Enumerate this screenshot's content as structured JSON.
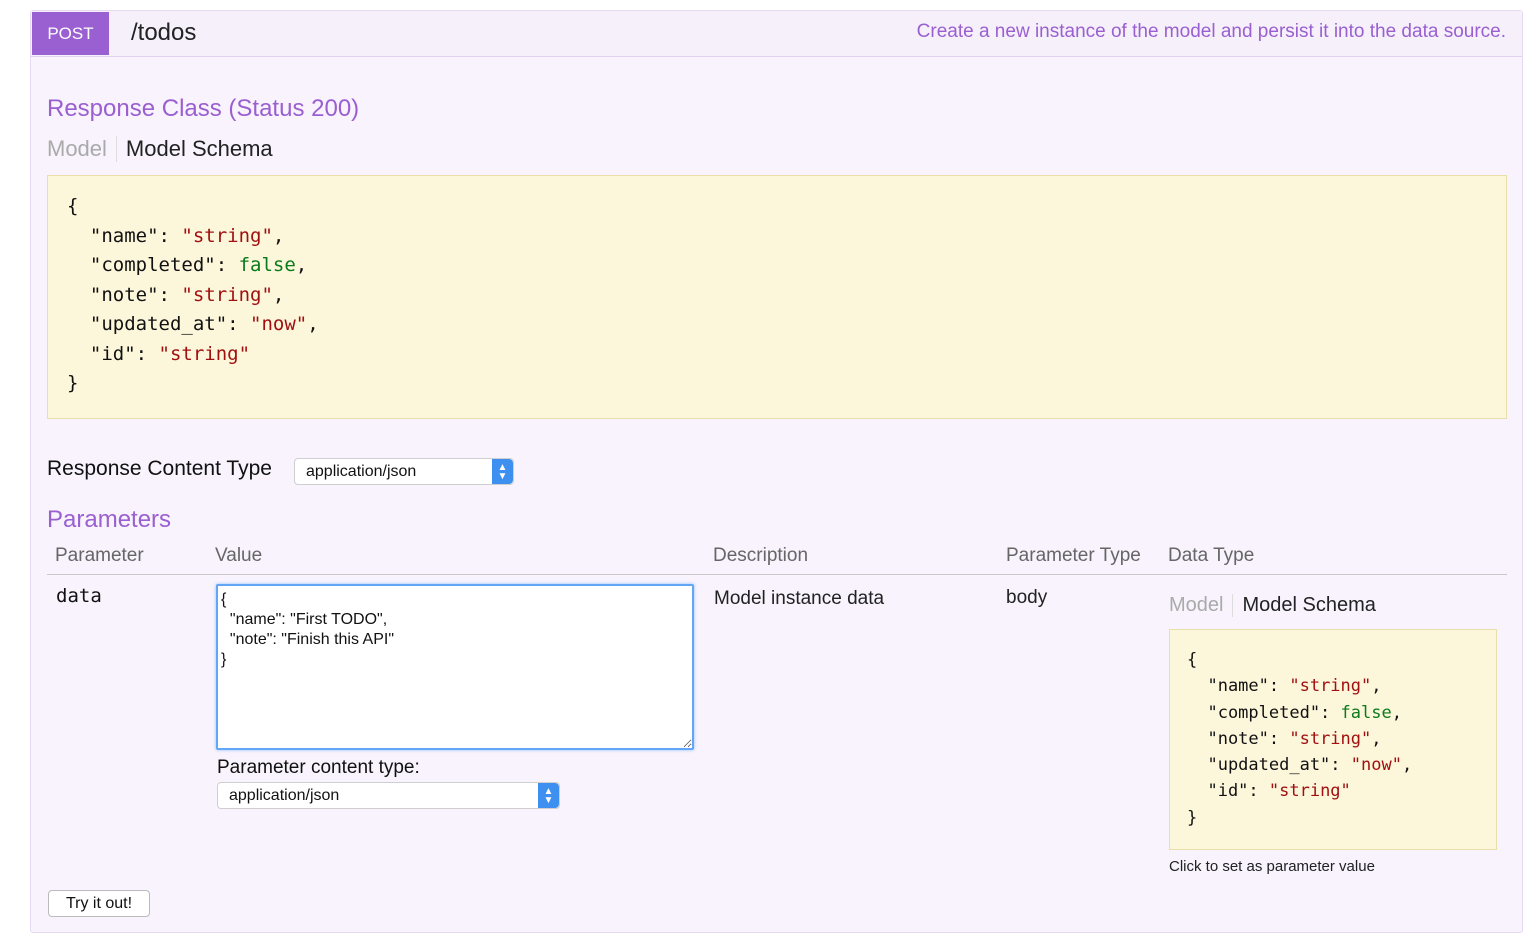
{
  "operation": {
    "method": "POST",
    "path": "/todos",
    "summary": "Create a new instance of the model and persist it into the data source.",
    "method_color": "#9a5fd0"
  },
  "response_class": {
    "heading": "Response Class (Status 200)",
    "tabs": [
      "Model",
      "Model Schema"
    ],
    "schema": {
      "open": "{",
      "close": "}",
      "fields": [
        {
          "key": "\"name\"",
          "value": "\"string\"",
          "type": "string",
          "comma": ","
        },
        {
          "key": "\"completed\"",
          "value": "false",
          "type": "bool",
          "comma": ","
        },
        {
          "key": "\"note\"",
          "value": "\"string\"",
          "type": "string",
          "comma": ","
        },
        {
          "key": "\"updated_at\"",
          "value": "\"now\"",
          "type": "string",
          "comma": ","
        },
        {
          "key": "\"id\"",
          "value": "\"string\"",
          "type": "string",
          "comma": ""
        }
      ]
    }
  },
  "response_content_type": {
    "label": "Response Content Type",
    "selected": "application/json"
  },
  "parameters": {
    "heading": "Parameters",
    "columns": [
      "Parameter",
      "Value",
      "Description",
      "Parameter Type",
      "Data Type"
    ],
    "row": {
      "name": "data",
      "value": "{\n  \"name\": \"First TODO\",\n  \"note\": \"Finish this API\"\n}",
      "content_type_label": "Parameter content type:",
      "content_type_selected": "application/json",
      "description": "Model instance data",
      "param_type": "body",
      "data_type_tabs": [
        "Model",
        "Model Schema"
      ],
      "hint": "Click to set as parameter value"
    }
  },
  "try_button": "Try it out!"
}
